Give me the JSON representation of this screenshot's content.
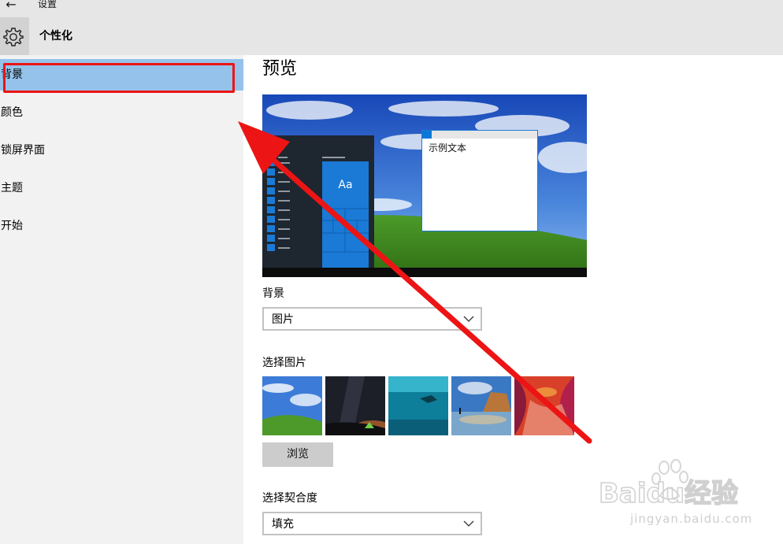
{
  "window": {
    "title": "设置",
    "back_icon": "back-arrow-icon"
  },
  "header": {
    "settings_icon": "gear-icon",
    "title": "个性化"
  },
  "sidebar": {
    "items": [
      {
        "label": "背景",
        "selected": true
      },
      {
        "label": "颜色",
        "selected": false
      },
      {
        "label": "锁屏界面",
        "selected": false
      },
      {
        "label": "主题",
        "selected": false
      },
      {
        "label": "开始",
        "selected": false
      }
    ]
  },
  "main": {
    "section_title": "预览",
    "preview": {
      "sample_text": "示例文本",
      "tile_text": "Aa"
    },
    "background": {
      "label": "背景",
      "value": "图片"
    },
    "choose_picture": {
      "label": "选择图片",
      "thumbnails": [
        "bliss-thumbnail",
        "night-sky-thumbnail",
        "underwater-thumbnail",
        "beach-rocks-thumbnail",
        "red-canyon-thumbnail"
      ],
      "browse_label": "浏览"
    },
    "fit": {
      "label": "选择契合度",
      "value": "填充"
    }
  },
  "watermark": {
    "logo_text": "Baidu经验",
    "url": "jingyan.baidu.com"
  },
  "colors": {
    "accent": "#0a78d7",
    "selected_bg": "#94c2ea",
    "annotation_red": "#ec1414",
    "sidebar_bg": "#f2f2f2"
  }
}
